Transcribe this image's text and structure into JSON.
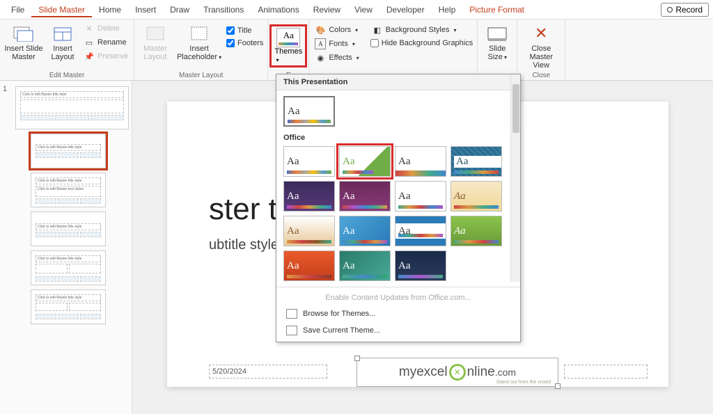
{
  "menu": {
    "file": "File",
    "slide_master": "Slide Master",
    "home": "Home",
    "insert": "Insert",
    "draw": "Draw",
    "transitions": "Transitions",
    "animations": "Animations",
    "review": "Review",
    "view": "View",
    "developer": "Developer",
    "help": "Help",
    "picture_format": "Picture Format",
    "record": "Record"
  },
  "ribbon": {
    "insert_slide_master": "Insert Slide Master",
    "insert_layout": "Insert Layout",
    "delete": "Delete",
    "rename": "Rename",
    "preserve": "Preserve",
    "edit_master_group": "Edit Master",
    "master_layout": "Master Layout",
    "insert_placeholder": "Insert Placeholder",
    "title_cb": "Title",
    "footers_cb": "Footers",
    "master_layout_group": "Master Layout",
    "themes": "Themes",
    "colors": "Colors",
    "fonts": "Fonts",
    "effects": "Effects",
    "bg_styles": "Background Styles",
    "hide_bg": "Hide Background Graphics",
    "slide_size": "Slide Size",
    "close_master": "Close Master View",
    "close_group": "Close"
  },
  "dropdown": {
    "this_presentation": "This Presentation",
    "office": "Office",
    "enable_updates": "Enable Content Updates from Office.com...",
    "browse": "Browse for Themes...",
    "save_theme": "Save Current Theme..."
  },
  "slide": {
    "title_text": "ster title style",
    "subtitle_text": "ubtitle style",
    "date": "5/20/2024",
    "logo_pre": "myexcel",
    "logo_post": "nline",
    "logo_dom": ".com",
    "logo_tag": "Stand out from the crowd"
  },
  "thumb": {
    "num": "1",
    "placeholder": "Click to edit Master title style",
    "sub": "Click to edit Master text styles"
  }
}
